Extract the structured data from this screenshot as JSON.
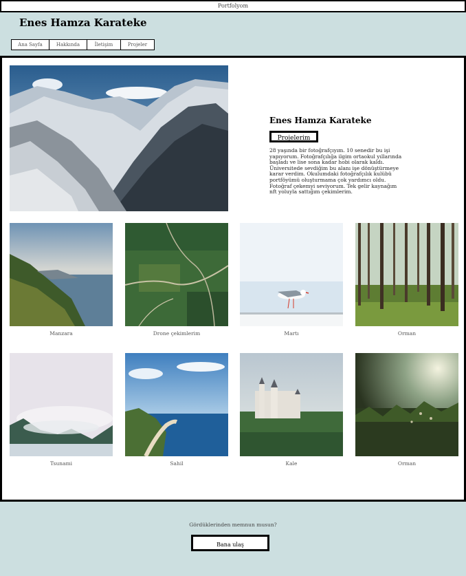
{
  "topbar": {
    "title": "Portfolyom"
  },
  "header": {
    "brand": "Enes Hamza Karateke"
  },
  "nav": {
    "items": [
      {
        "label": "Ana Sayfa"
      },
      {
        "label": "Hakkında"
      },
      {
        "label": "İletişim"
      },
      {
        "label": "Projeler"
      }
    ]
  },
  "hero": {
    "name": "Enes Hamza Karateke",
    "button_label": "Projelerim",
    "description": "28 yaşında bir fotoğrafçıyım. 10 senedir bu işi yapıyorum. Fotoğrafçılığa ilgim ortaokul yıllarında başladı ve lise sona kadar hobi olarak kaldı. Üniversitede sevdiğim bu alanı işe dönüştürmeye karar verdim. Okulumdaki fotoğrafçılık kulübü portföyümü oluşturmama çok yardımcı oldu. Fotoğraf çekemyi seviyorum. Tek gelir kaynağım nft yoluyla sattığım çekimlerim."
  },
  "gallery": [
    {
      "caption": "Manzara"
    },
    {
      "caption": "Drone çekimlerim"
    },
    {
      "caption": "Martı"
    },
    {
      "caption": "Orman"
    },
    {
      "caption": "Tsunami"
    },
    {
      "caption": "Sahil"
    },
    {
      "caption": "Kale"
    },
    {
      "caption": "Orman"
    }
  ],
  "footer": {
    "question": "Gördüklerinden memnun musun?",
    "button_label": "Bana ulaş"
  }
}
